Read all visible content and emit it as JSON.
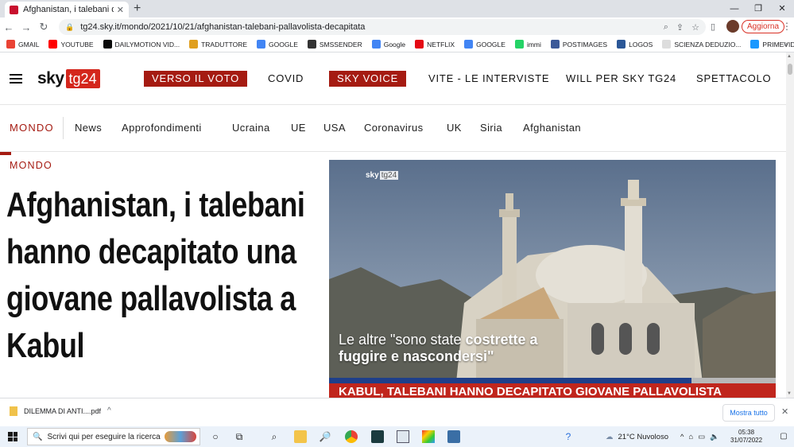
{
  "browser": {
    "tab_title": "Afghanistan, i talebani decapitan",
    "tab_close": "✕",
    "new_tab": "+",
    "window_controls": [
      "—",
      "❐",
      "✕"
    ],
    "url": "tg24.sky.it/mondo/2021/10/21/afghanistan-talebani-pallavolista-decapitata",
    "update_button": "Aggiorna",
    "bookmarks": [
      {
        "label": "GMAIL",
        "color": "#ea4335"
      },
      {
        "label": "YOUTUBE",
        "color": "#ff0000"
      },
      {
        "label": "DAILYMOTION VID...",
        "color": "#0a0a0a"
      },
      {
        "label": "TRADUTTORE",
        "color": "#e0a020"
      },
      {
        "label": "GOOGLE",
        "color": "#4285f4"
      },
      {
        "label": "SMSSENDER",
        "color": "#333333"
      },
      {
        "label": "Google",
        "color": "#4285f4"
      },
      {
        "label": "NETFLIX",
        "color": "#e50914"
      },
      {
        "label": "GOOGLE",
        "color": "#4285f4"
      },
      {
        "label": "immi",
        "color": "#25d366"
      },
      {
        "label": "POSTIMAGES",
        "color": "#3b5998"
      },
      {
        "label": "LOGOS",
        "color": "#2b5797"
      },
      {
        "label": "SCIENZA DEDUZIO...",
        "color": "#dddddd"
      },
      {
        "label": "PRIMEVIDEO",
        "color": "#1a98ff"
      }
    ],
    "bookmarks_more": "»"
  },
  "site": {
    "logo_sky": "sky",
    "logo_tg": "tg24",
    "top_nav": [
      "VERSO IL VOTO",
      "COVID",
      "SKY VOICE",
      "VITE - LE INTERVISTE",
      "WILL PER SKY TG24",
      "SPETTACOLO"
    ],
    "sub_nav_active": "MONDO",
    "sub_nav": [
      "News",
      "Approfondimenti",
      "Ucraina",
      "UE",
      "USA",
      "Coronavirus",
      "UK",
      "Siria",
      "Afghanistan"
    ]
  },
  "article": {
    "kicker": "MONDO",
    "headline": "Afghanistan, i talebani hanno decapitato una giovane pallavolista a Kabul",
    "video_watermark_sky": "sky",
    "video_watermark_tg": "tg24",
    "video_caption_plain": "Le altre \"sono state ",
    "video_caption_bold": "costrette a fuggire e nascondersi\"",
    "video_banner": "KABUL, TALEBANI HANNO DECAPITATO GIOVANE PALLAVOLISTA"
  },
  "downloads": {
    "file": "DILEMMA DI ANTI....pdf",
    "chevron": "^",
    "show_all": "Mostra tutto",
    "close": "✕"
  },
  "taskbar": {
    "search_placeholder": "Scrivi qui per eseguire la ricerca",
    "weather": "21°C Nuvoloso",
    "time": "05:38",
    "date": "31/07/2022"
  }
}
